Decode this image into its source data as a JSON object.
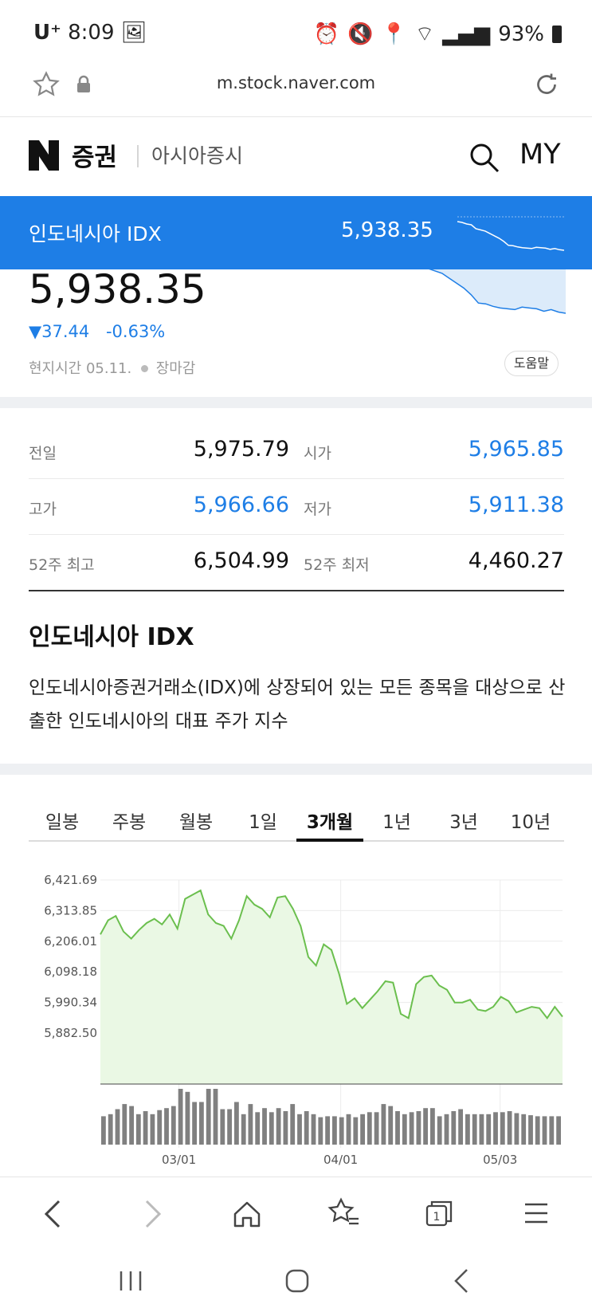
{
  "status_bar": {
    "carrier": "U⁺",
    "time": "8:09",
    "battery": "93%"
  },
  "url_bar": {
    "url": "m.stock.naver.com"
  },
  "header": {
    "brand": "증권",
    "section": "아시아증시",
    "my_label": "MY"
  },
  "sticky_bar": {
    "name": "인도네시아 IDX",
    "value": "5,938.35"
  },
  "price": {
    "value": "5,938.35",
    "change_abs": "37.44",
    "change_pct": "-0.63%",
    "local_time": "현지시간 05.11.",
    "market_status": "장마감",
    "help_label": "도움말"
  },
  "stats": [
    {
      "label": "전일",
      "value": "5,975.79",
      "label2": "시가",
      "value2": "5,965.85"
    },
    {
      "label": "고가",
      "value": "5,966.66",
      "label2": "저가",
      "value2": "5,911.38"
    },
    {
      "label": "52주 최고",
      "value": "6,504.99",
      "label2": "52주 최저",
      "value2": "4,460.27"
    }
  ],
  "description": {
    "title": "인도네시아 IDX",
    "text": "인도네시아증권거래소(IDX)에 상장되어 있는 모든 종목을 대상으로 산출한 인도네시아의 대표 주가 지수"
  },
  "tabs": [
    "일봉",
    "주봉",
    "월봉",
    "1일",
    "3개월",
    "1년",
    "3년",
    "10년"
  ],
  "active_tab": "3개월",
  "colors": {
    "accent": "#1e7ee6",
    "line_green": "#6bbf4e",
    "area_green": "#eaf8e4",
    "volume": "#808080"
  },
  "chart_data": {
    "type": "area",
    "y_ticks": [
      "6,421.69",
      "6,313.85",
      "6,206.01",
      "6,098.18",
      "5,990.34",
      "5,882.50"
    ],
    "ylim": [
      5882.5,
      6421.69
    ],
    "x_ticks": [
      "03/01",
      "04/01",
      "05/03"
    ],
    "values": [
      6230,
      6280,
      6295,
      6240,
      6215,
      6245,
      6270,
      6285,
      6265,
      6300,
      6250,
      6355,
      6370,
      6385,
      6300,
      6270,
      6260,
      6215,
      6280,
      6365,
      6335,
      6320,
      6290,
      6360,
      6365,
      6320,
      6260,
      6150,
      6120,
      6195,
      6175,
      6090,
      5985,
      6005,
      5970,
      6000,
      6030,
      6065,
      6060,
      5950,
      5935,
      6055,
      6080,
      6085,
      6050,
      6035,
      5990,
      5990,
      6000,
      5965,
      5960,
      5975,
      6010,
      5995,
      5955,
      5965,
      5975,
      5970,
      5935,
      5975,
      5940
    ],
    "volume": [
      28,
      30,
      35,
      40,
      38,
      30,
      33,
      30,
      34,
      36,
      38,
      55,
      52,
      42,
      42,
      55,
      55,
      35,
      35,
      42,
      30,
      40,
      32,
      36,
      32,
      36,
      33,
      40,
      30,
      33,
      30,
      27,
      28,
      28,
      27,
      30,
      27,
      30,
      32,
      32,
      40,
      38,
      33,
      30,
      32,
      33,
      36,
      36,
      28,
      30,
      33,
      35,
      30,
      30,
      30,
      30,
      32,
      32,
      33,
      31,
      30,
      29,
      28,
      28,
      28,
      28
    ]
  },
  "mini_chart_values": [
    6300,
    6290,
    6270,
    6260,
    6210,
    6195,
    6180,
    6150,
    6120,
    6090,
    6050,
    6000,
    5995,
    5980,
    5970,
    5965,
    5960,
    5975,
    5970,
    5965,
    5950,
    5960,
    5945,
    5938
  ]
}
